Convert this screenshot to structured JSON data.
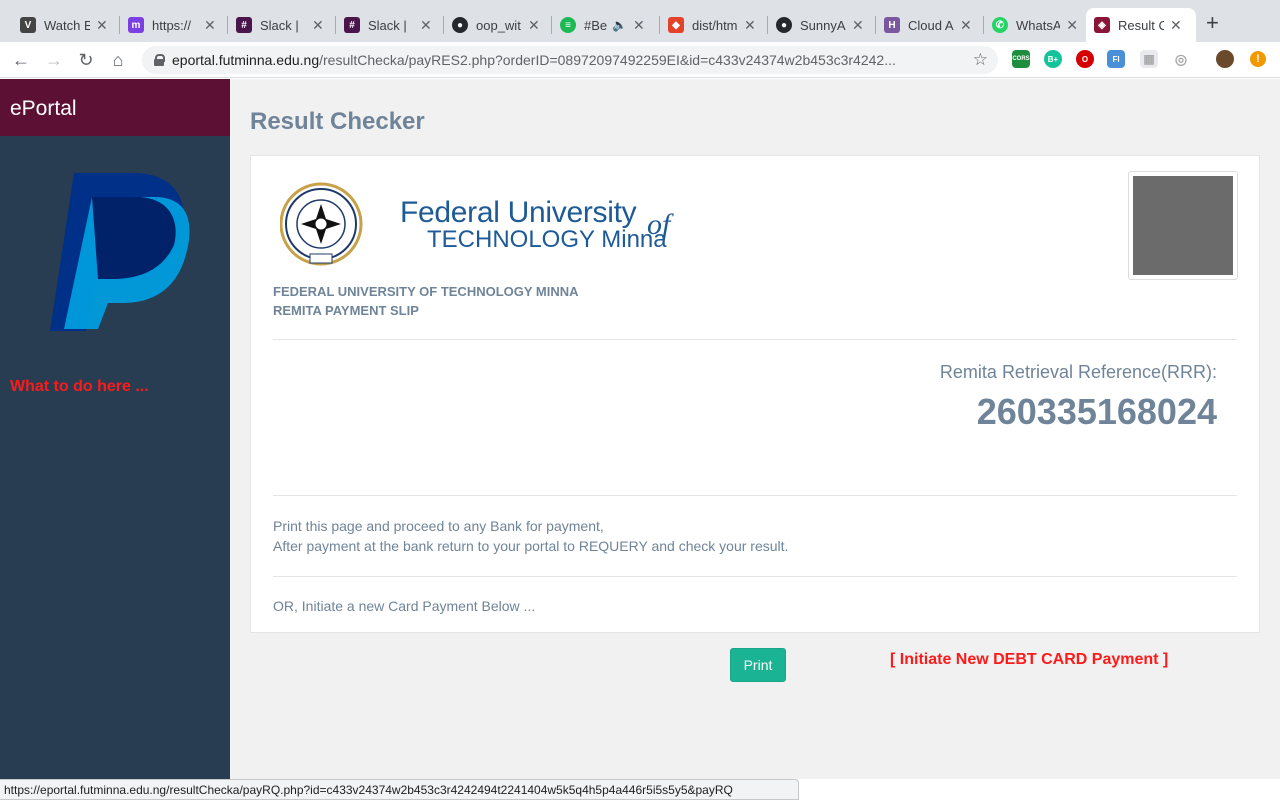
{
  "browser": {
    "tabs": [
      {
        "title": "Watch E",
        "icon": "v-logo-icon",
        "color": "#444444",
        "glyph": "V"
      },
      {
        "title": "https://",
        "icon": "m-logo-icon",
        "color": "#7b3fe4",
        "glyph": "m"
      },
      {
        "title": "Slack |",
        "icon": "slack-icon",
        "color": "#4a154b",
        "glyph": "#"
      },
      {
        "title": "Slack |",
        "icon": "slack-icon",
        "color": "#4a154b",
        "glyph": "#"
      },
      {
        "title": "oop_wit",
        "icon": "github-icon",
        "color": "#24292e",
        "glyph": "●"
      },
      {
        "title": "#Be",
        "icon": "spotify-icon",
        "color": "#1db954",
        "glyph": "≡"
      },
      {
        "title": "dist/htm",
        "icon": "gitlab-icon",
        "color": "#e24329",
        "glyph": "◆"
      },
      {
        "title": "SunnyA",
        "icon": "github-icon",
        "color": "#24292e",
        "glyph": "●"
      },
      {
        "title": "Cloud A",
        "icon": "heroku-icon",
        "color": "#79589f",
        "glyph": "H"
      },
      {
        "title": "WhatsA",
        "icon": "whatsapp-icon",
        "color": "#25d366",
        "glyph": "✆"
      },
      {
        "title": "Result C",
        "icon": "futminna-icon",
        "color": "#8a1538",
        "glyph": "◈"
      }
    ],
    "new_tab": "+",
    "url_host": "eportal.futminna.edu.ng",
    "url_path": "/resultChecka/payRES2.php?orderID=08972097492259EI&id=c433v24374w2b453c3r4242...",
    "extensions": [
      {
        "name": "cors-extension-icon",
        "label": "CORS",
        "color": "#1e8e3e"
      },
      {
        "name": "grammarly-icon",
        "label": "B+",
        "color": "#15c39a"
      },
      {
        "name": "opera-icon",
        "label": "O",
        "color": "#d50000"
      },
      {
        "name": "fi-extension-icon",
        "label": "FI",
        "color": "#4a90d9"
      },
      {
        "name": "grid-extension-icon",
        "label": "▦",
        "color": "#c9c9c9"
      },
      {
        "name": "circle-extension-icon",
        "label": "◎",
        "color": "#c9c9c9"
      },
      {
        "name": "profile-avatar-icon",
        "label": "",
        "color": "#6b4a2b"
      },
      {
        "name": "update-alert-icon",
        "label": "!",
        "color": "#f29900"
      }
    ]
  },
  "sidebar": {
    "brand": "ePortal",
    "link": "What to do here ..."
  },
  "main": {
    "title": "Result Checker",
    "logo_line1": "Federal University",
    "logo_line2": "TECHNOLOGY Minna",
    "logo_of": "of",
    "slip_line1": "FEDERAL UNIVERSITY OF TECHNOLOGY MINNA",
    "slip_line2": "REMITA PAYMENT SLIP",
    "rrr_label": "Remita Retrieval Reference(RRR):",
    "rrr_value": "260335168024",
    "instruction1": "Print this page and proceed to any Bank for payment,",
    "instruction2": "After payment at the bank return to your portal to REQUERY and check your result.",
    "or_text": "OR, Initiate a new Card Payment Below ...",
    "print_label": "Print",
    "debit_link": "[ Initiate New DEBT CARD Payment ]"
  },
  "status_bar": {
    "url": "https://eportal.futminna.edu.ng/resultChecka/payRQ.php?id=c433v24374w2b453c3r4242494t2241404w5k5q4h5p4a446r5i5s5y5&payRQ"
  }
}
